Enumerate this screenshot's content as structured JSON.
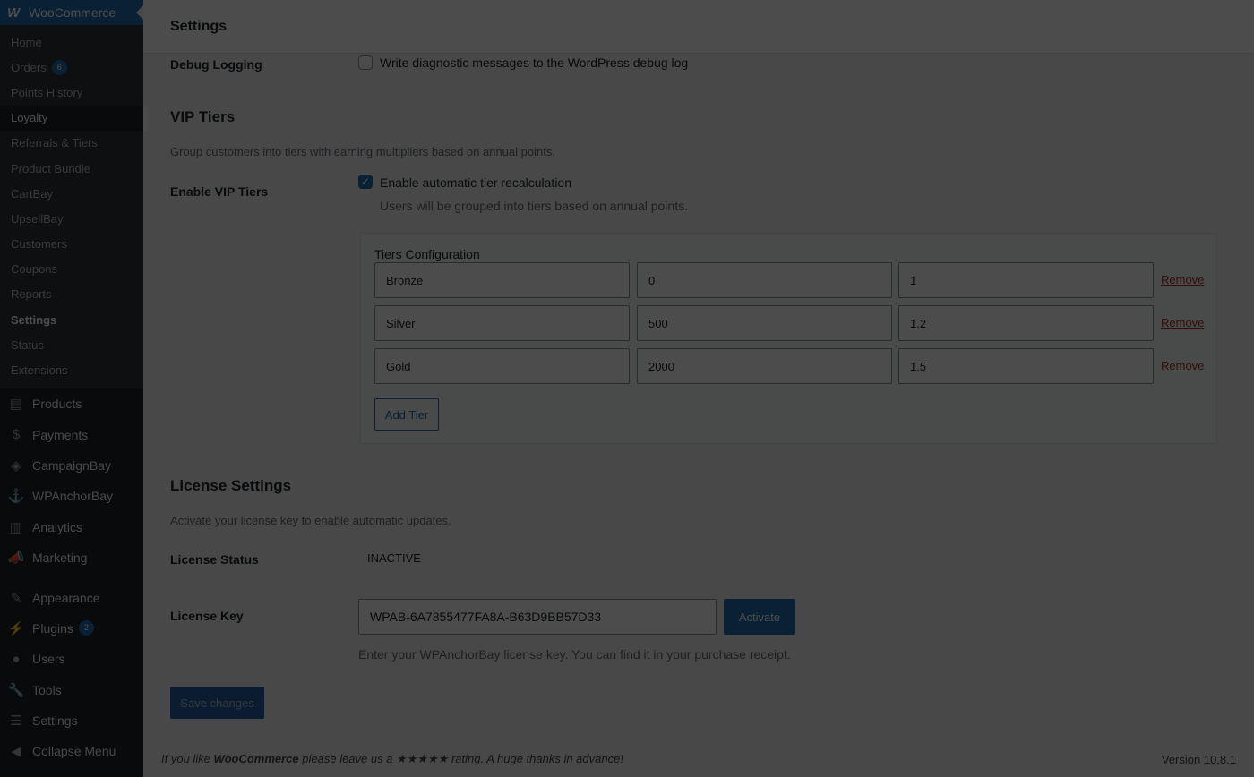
{
  "sidebar": {
    "brand": "WooCommerce",
    "sub_items": [
      {
        "label": "Home"
      },
      {
        "label": "Orders",
        "badge": "6"
      },
      {
        "label": "Points History"
      },
      {
        "label": "Loyalty"
      },
      {
        "label": "Referrals & Tiers"
      },
      {
        "label": "Product Bundle"
      },
      {
        "label": "CartBay"
      },
      {
        "label": "UpsellBay"
      },
      {
        "label": "Customers"
      },
      {
        "label": "Coupons"
      },
      {
        "label": "Reports"
      },
      {
        "label": "Settings"
      },
      {
        "label": "Status"
      },
      {
        "label": "Extensions"
      }
    ],
    "main_items": [
      {
        "label": "Products",
        "icon": "archive-icon"
      },
      {
        "label": "Payments",
        "icon": "dollar-icon"
      },
      {
        "label": "CampaignBay",
        "icon": "campaign-icon"
      },
      {
        "label": "WPAnchorBay",
        "icon": "anchor-icon"
      },
      {
        "label": "Analytics",
        "icon": "bar-chart-icon"
      },
      {
        "label": "Marketing",
        "icon": "megaphone-icon"
      },
      {
        "label": "Appearance",
        "icon": "brush-icon"
      },
      {
        "label": "Plugins",
        "icon": "plug-icon",
        "badge": "2"
      },
      {
        "label": "Users",
        "icon": "user-icon"
      },
      {
        "label": "Tools",
        "icon": "wrench-icon"
      },
      {
        "label": "Settings",
        "icon": "sliders-icon"
      },
      {
        "label": "Collapse Menu",
        "icon": "collapse-icon"
      }
    ]
  },
  "header": {
    "title": "Settings"
  },
  "debug": {
    "label": "Debug Logging",
    "checkbox_label": "Write diagnostic messages to the WordPress debug log"
  },
  "vip": {
    "title": "VIP Tiers",
    "description": "Group customers into tiers with earning multipliers based on annual points.",
    "enable_label": "Enable VIP Tiers",
    "checkbox_label": "Enable automatic tier recalculation",
    "checkbox_help": "Users will be grouped into tiers based on annual points.",
    "config_title": "Tiers Configuration",
    "tiers": [
      {
        "name": "Bronze",
        "points": "0",
        "multiplier": "1"
      },
      {
        "name": "Silver",
        "points": "500",
        "multiplier": "1.2"
      },
      {
        "name": "Gold",
        "points": "2000",
        "multiplier": "1.5"
      }
    ],
    "remove_label": "Remove",
    "add_label": "Add Tier"
  },
  "license": {
    "title": "License Settings",
    "description": "Activate your license key to enable automatic updates.",
    "status_label": "License Status",
    "status_value": "INACTIVE",
    "key_label": "License Key",
    "key_value": "WPAB-6A7855477FA8A-B63D9BB57D33",
    "activate_label": "Activate",
    "help": "Enter your WPAnchorBay license key. You can find it in your purchase receipt."
  },
  "save_label": "Save changes",
  "footer": {
    "left_prefix": "If you like ",
    "left_brand": "WooCommerce",
    "left_suffix": " please leave us a ★★★★★ rating. A huge thanks in advance!",
    "version": "Version 10.8.1"
  },
  "colors": {
    "accent": "#2271b1",
    "sidebar_bg": "#1d2327",
    "remove": "#b32d2e"
  }
}
